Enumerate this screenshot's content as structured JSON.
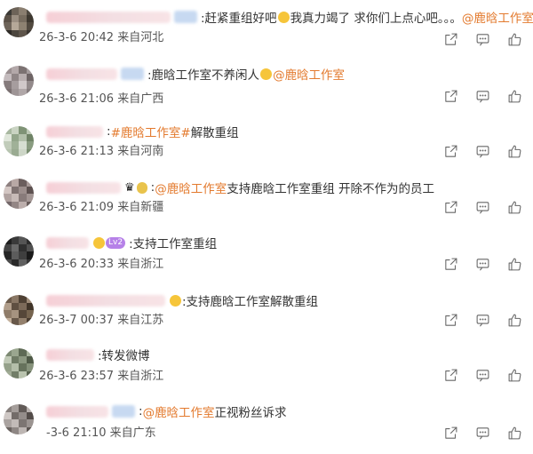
{
  "comments": [
    {
      "name_width": 140,
      "avatar": [
        "#3c3a36",
        "#6d6358",
        "#8a7e70",
        "#4e4840",
        "#5b5147",
        "#9b8f82",
        "#766b5e",
        "#3d372f",
        "#6e6459",
        "#b5a898",
        "#8d8171",
        "#51493f",
        "#2f2b27",
        "#4c463e",
        "#5e554b",
        "#3a3530"
      ],
      "badge": "",
      "segments": [
        {
          "t": ":赶紧重组好吧",
          "c": "txt"
        },
        {
          "t": "",
          "c": "emoji"
        },
        {
          "t": "我真力竭了 求你们上点心吧。。。",
          "c": "txt"
        },
        {
          "t": "@鹿晗工作室",
          "c": "at"
        }
      ],
      "meta": "26-3-6 20:42 来自河北"
    },
    {
      "name_width": 80,
      "avatar": [
        "#9a8f90",
        "#b3a8a9",
        "#7c7272",
        "#a39a9b",
        "#c4bbbd",
        "#8f8586",
        "#b8aeaf",
        "#6e6465",
        "#857b7c",
        "#a69d9e",
        "#d0c8c9",
        "#938a8b",
        "#7a7071",
        "#9e9596",
        "#b0a7a8",
        "#867d7e"
      ],
      "badge": "",
      "segments": [
        {
          "t": ":鹿晗工作室不养闲人",
          "c": "txt"
        },
        {
          "t": "",
          "c": "emoji"
        },
        {
          "t": "@鹿晗工作室",
          "c": "at"
        }
      ],
      "meta": "26-3-6 21:06 来自广西"
    },
    {
      "name_width": 64,
      "avatar": [
        "#a8b8a0",
        "#c9d3c2",
        "#7f9376",
        "#bcc8b5",
        "#dfe6da",
        "#93a68b",
        "#b2c0aa",
        "#6f8366",
        "#c1ccba",
        "#a0b198",
        "#d6ded1",
        "#899c80",
        "#b7c4b0",
        "#9aab92",
        "#cdd6c7",
        "#7a8e71"
      ],
      "badge": "",
      "segments": [
        {
          "t": ":",
          "c": "txt"
        },
        {
          "t": "#鹿晗工作室#",
          "c": "at"
        },
        {
          "t": " 解散重组",
          "c": "txt"
        }
      ],
      "meta": "26-3-6 21:13 来自河南"
    },
    {
      "name_width": 84,
      "avatar": [
        "#8e8080",
        "#b8a8a5",
        "#6b5e5d",
        "#a69896",
        "#d3c6c3",
        "#7f7271",
        "#9c8e8c",
        "#5d5150",
        "#b0a2a0",
        "#c7bab7",
        "#887b7a",
        "#a39694",
        "#74686a",
        "#938685",
        "#bcaeac",
        "#695d5c"
      ],
      "badge": "crown",
      "segments": [
        {
          "t": ":",
          "c": "txt"
        },
        {
          "t": "@鹿晗工作室",
          "c": "at"
        },
        {
          "t": " 支持鹿晗工作室重组 开除不作为的员工",
          "c": "txt"
        }
      ],
      "meta": "26-3-6 21:09 来自新疆"
    },
    {
      "name_width": 48,
      "avatar": [
        "#1f1f1f",
        "#3a3a3a",
        "#555555",
        "#2c2c2c",
        "#444444",
        "#6a6a6a",
        "#303030",
        "#505050",
        "#262626",
        "#5c5c5c",
        "#3f3f3f",
        "#1a1a1a",
        "#4a4a4a",
        "#2a2a2a",
        "#606060",
        "#353535"
      ],
      "badge": "lv",
      "badge_text": "Lv2",
      "segments": [
        {
          "t": ":支持工作室重组",
          "c": "txt"
        }
      ],
      "meta": "26-3-6 20:33 来自浙江"
    },
    {
      "name_width": 134,
      "avatar": [
        "#6b5a4a",
        "#8a7765",
        "#4f4134",
        "#9d8a77",
        "#b19e8b",
        "#5f4f41",
        "#7c6a59",
        "#403428",
        "#8f7c69",
        "#a69380",
        "#564739",
        "#76644f",
        "#c3b09c",
        "#68584a",
        "#93806d",
        "#4a3d31"
      ],
      "badge": "small",
      "segments": [
        {
          "t": ":支持鹿晗工作室解散重组",
          "c": "txt"
        }
      ],
      "meta": "26-3-7 00:37 来自江苏"
    },
    {
      "name_width": 54,
      "avatar": [
        "#7d8a73",
        "#9aa68f",
        "#5e6a55",
        "#a8b39d",
        "#c0c9b6",
        "#6f7b65",
        "#8c9881",
        "#4f5a47",
        "#95a18a",
        "#b4bea9",
        "#66725c",
        "#86927b",
        "#a0ab95",
        "#727e68",
        "#bac4af",
        "#58634f"
      ],
      "badge": "",
      "segments": [
        {
          "t": ":转发微博",
          "c": "txt"
        }
      ],
      "meta": "26-3-6 23:57 来自浙江"
    },
    {
      "name_width": 70,
      "avatar": [
        "#867f7c",
        "#a59e9b",
        "#625b58",
        "#b7b0ad",
        "#cfc8c5",
        "#736c69",
        "#948d8a",
        "#534c49",
        "#aaa3a0",
        "#c2bbb8",
        "#7c7572",
        "#9b9491",
        "#6a6360",
        "#8e8784",
        "#bdb6b3",
        "#5b5451"
      ],
      "badge": "",
      "segments": [
        {
          "t": ":",
          "c": "txt"
        },
        {
          "t": "@鹿晗工作室",
          "c": "at"
        },
        {
          "t": " 正视粉丝诉求",
          "c": "txt"
        }
      ],
      "meta": "-3-6 21:10 来自广东"
    }
  ]
}
